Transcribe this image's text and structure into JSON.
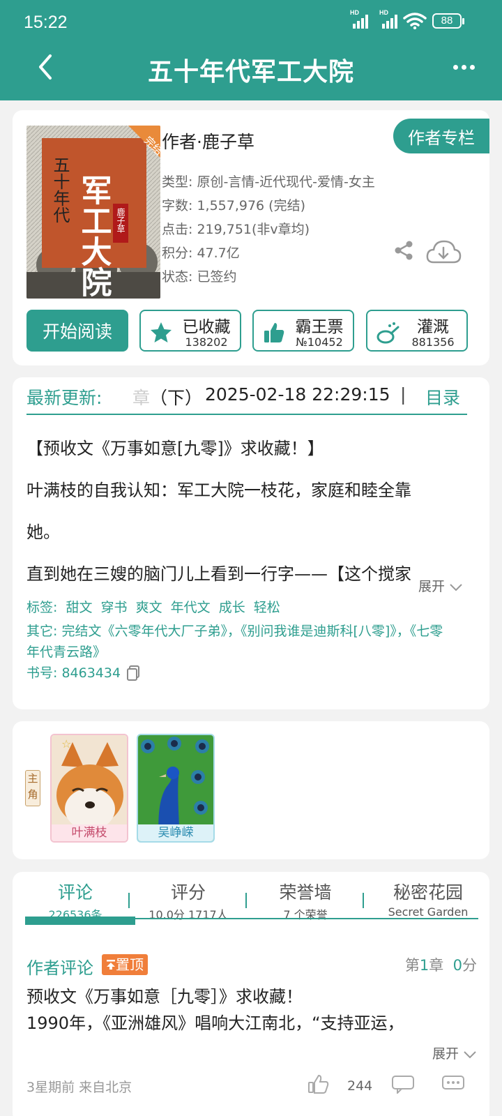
{
  "status_bar": {
    "time": "15:22",
    "battery": "88",
    "net1": "HD",
    "net2": "HD"
  },
  "header": {
    "title": "五十年代军工大院"
  },
  "book": {
    "cover_title": "军工大院",
    "cover_subtitle": "五十年代",
    "cover_badge": "完结",
    "cover_author": "鹿子草",
    "author_label": "作者·鹿子草",
    "author_column_button": "作者专栏",
    "meta": [
      "类型: 原创-言情-近代现代-爱情-女主",
      "字数: 1,557,976 (完结)",
      "点击: 219,751(非v章均)",
      "积分: 47.7亿",
      "状态: 已签约"
    ],
    "start_reading": "开始阅读",
    "actions": [
      {
        "label": "已收藏",
        "count": "138202",
        "icon": "star-icon"
      },
      {
        "label": "霸王票",
        "count": "№10452",
        "icon": "thumb-icon"
      },
      {
        "label": "灌溉",
        "count": "881356",
        "icon": "watering-can-icon"
      }
    ]
  },
  "latest": {
    "label": "最新更新:",
    "chapter_fade": "章",
    "chapter": "（下）",
    "time": "2025-02-18 22:29:15",
    "separator": "|",
    "toc": "目录"
  },
  "intro": {
    "lines": [
      "【预收文《万事如意[九零]》求收藏！】",
      "叶满枝的自我认知：军工大院一枝花，家庭和睦全靠",
      "她。",
      "直到她在三嫂的脑门儿上看到一行字——【这个搅家"
    ],
    "expand": "展开",
    "tags_label": "标签:",
    "tags": [
      "甜文",
      "穿书",
      "爽文",
      "年代文",
      "成长",
      "轻松"
    ],
    "other": "其它:  完结文《六零年代大厂子弟》，《别问我谁是迪斯科[八零]》，《七零年代青云路》",
    "book_no": "书号:  8463434"
  },
  "characters": {
    "role_tag": "主角",
    "list": [
      {
        "name": "叶满枝"
      },
      {
        "name": "吴峥嵘"
      }
    ]
  },
  "tabs": [
    {
      "title": "评论",
      "sub": "226536条"
    },
    {
      "title": "评分",
      "sub": "10.0分 1717人"
    },
    {
      "title": "荣誉墙",
      "sub": "7 个荣誉"
    },
    {
      "title": "秘密花园",
      "sub": "Secret Garden"
    }
  ],
  "comment": {
    "title": "作者评论",
    "pin": "置顶",
    "chapter_prefix": "第",
    "chapter_num": "1",
    "chapter_suffix": "章",
    "score_num": "0",
    "score_suffix": "分",
    "lines": [
      "预收文《万事如意［九零］》求收藏！",
      "1990年，《亚洲雄风》唱响大江南北，“支持亚运，"
    ],
    "expand": "展开",
    "meta": "3星期前  来自北京",
    "likes": "244"
  },
  "colors": {
    "accent": "#2e9e8f",
    "pin": "#f07e3a"
  }
}
